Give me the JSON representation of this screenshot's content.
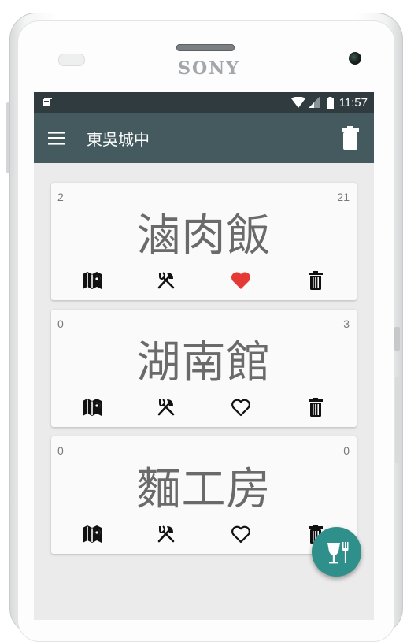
{
  "device": {
    "brand": "SONY"
  },
  "status_bar": {
    "time": "11:57"
  },
  "app_bar": {
    "title": "東吳城中"
  },
  "restaurants": [
    {
      "name": "滷肉飯",
      "left_count": "2",
      "right_count": "21",
      "favorite": true
    },
    {
      "name": "湖南館",
      "left_count": "0",
      "right_count": "3",
      "favorite": false
    },
    {
      "name": "麵工房",
      "left_count": "0",
      "right_count": "0",
      "favorite": false
    }
  ],
  "colors": {
    "app_bar": "#455a5e",
    "status_bar": "#2f3b3e",
    "favorite": "#e53935",
    "fab": "#2f8f8a",
    "background": "#ebebeb"
  },
  "icons": {
    "menu": "menu-icon",
    "delete_all": "trash-icon",
    "map": "map-icon",
    "eat": "fork-knife-icon",
    "favorite": "heart-icon",
    "delete": "trash-icon",
    "fab": "drink-fork-icon"
  }
}
